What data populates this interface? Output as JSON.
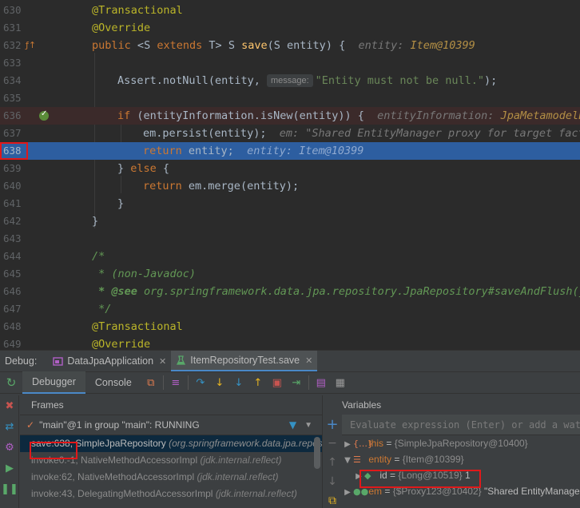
{
  "editor": {
    "lines": [
      {
        "num": "630",
        "text": "@Transactional"
      },
      {
        "num": "631",
        "text": "@Override"
      },
      {
        "num": "632",
        "kw1": "public",
        "lt": "<",
        "sparam": "S",
        "ext": "extends",
        "tparam": "T",
        "gt": ">",
        "ret": "S",
        "method": "save",
        "open": "(",
        "ptype": "S",
        "pname": "entity",
        "close": ") {",
        "hint_label": "entity:",
        "hint_value": "Item@10399"
      },
      {
        "num": "633",
        "text": ""
      },
      {
        "num": "634",
        "pre": "Assert.",
        "method": "notNull",
        "args": "(entity, ",
        "param_hint": "message:",
        "str": "\"Entity must not be null.\"",
        "end": ");"
      },
      {
        "num": "635",
        "text": ""
      },
      {
        "num": "636",
        "kw": "if",
        "pre": " (entityInformation.",
        "method": "isNew",
        "post": "(entity)) {",
        "hint_label": "entityInformation:",
        "hint_value": "JpaMetamodelEntityInformation"
      },
      {
        "num": "637",
        "pre": "em.",
        "method": "persist",
        "post": "(entity);",
        "hint_label": "em:",
        "hint_value": "\"Shared EntityManager proxy for target factory\""
      },
      {
        "num": "638",
        "kw": "return",
        "post": " entity;",
        "hint_label": "entity:",
        "hint_value": "Item@10399"
      },
      {
        "num": "639",
        "pre": "} ",
        "kw": "else",
        "post": " {"
      },
      {
        "num": "640",
        "kw": "return",
        "pre": " em.",
        "method": "merge",
        "post": "(entity);"
      },
      {
        "num": "641",
        "text": "}"
      },
      {
        "num": "642",
        "text": "}"
      },
      {
        "num": "643",
        "text": ""
      },
      {
        "num": "644",
        "text": "/*"
      },
      {
        "num": "645",
        "text": " * (non-Javadoc)"
      },
      {
        "num": "646",
        "tag": " * @see",
        "text": " org.springframework.data.jpa.repository.JpaRepository#saveAndFlush(java.lang.Object)"
      },
      {
        "num": "647",
        "text": " */"
      },
      {
        "num": "648",
        "text": "@Transactional"
      },
      {
        "num": "649",
        "text": "@Override"
      }
    ]
  },
  "debug": {
    "label": "Debug:",
    "tabs": [
      {
        "label": "DataJpaApplication"
      },
      {
        "label": "ItemRepositoryTest.save"
      }
    ],
    "subtabs": [
      "Debugger",
      "Console"
    ],
    "frames_title": "Frames",
    "variables_title": "Variables",
    "thread": "\"main\"@1 in group \"main\": RUNNING",
    "frames": [
      {
        "loc": "save:638,",
        "cls": "SimpleJpaRepository",
        "pkg": "(org.springframework.data.jpa.repository.support)"
      },
      {
        "loc": "invoke0:-1,",
        "cls": "NativeMethodAccessorImpl",
        "pkg": "(jdk.internal.reflect)"
      },
      {
        "loc": "invoke:62,",
        "cls": "NativeMethodAccessorImpl",
        "pkg": "(jdk.internal.reflect)"
      },
      {
        "loc": "invoke:43,",
        "cls": "DelegatingMethodAccessorImpl",
        "pkg": "(jdk.internal.reflect)"
      }
    ],
    "eval_placeholder": "Evaluate expression (Enter) or add a watch (Ctrl+Shift+Enter)",
    "variables": [
      {
        "name": "this",
        "type": "{SimpleJpaRepository@10400}",
        "value": ""
      },
      {
        "name": "entity",
        "type": "{Item@10399}",
        "value": ""
      },
      {
        "name": "id",
        "type": "{Long@10519}",
        "value": "1"
      },
      {
        "name": "em",
        "type": "{$Proxy123@10402}",
        "value": "\"Shared EntityManager proxy for target factory\""
      }
    ]
  },
  "colors": {
    "editor_bg": "#2b2b2b",
    "current_line": "#2d5ea0",
    "breakpoint_line": "#3b2a2a",
    "annotation_highlight": "#e0191a",
    "keyword": "#cc7832"
  }
}
